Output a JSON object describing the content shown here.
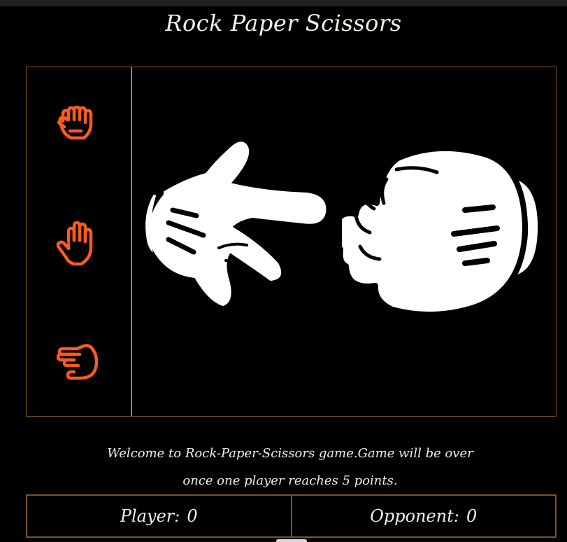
{
  "title": "Rock Paper Scissors",
  "choices": [
    {
      "name": "rock",
      "icon": "fist-icon"
    },
    {
      "name": "paper",
      "icon": "open-hand-icon"
    },
    {
      "name": "scissors",
      "icon": "scissors-hand-icon"
    }
  ],
  "arena": {
    "player_hand": "paper-hand-icon",
    "opponent_hand": "rock-hand-icon"
  },
  "message": {
    "line1": "Welcome to Rock-Paper-Scissors game.Game will be over",
    "line2": "once one player reaches 5 points."
  },
  "score": {
    "player_label": "Player:",
    "player_value": "0",
    "opponent_label": "Opponent:",
    "opponent_value": "0"
  },
  "colors": {
    "accent": "#ff5a1f",
    "border": "#7a5322",
    "background": "#000000",
    "text": "#f1efe6"
  }
}
